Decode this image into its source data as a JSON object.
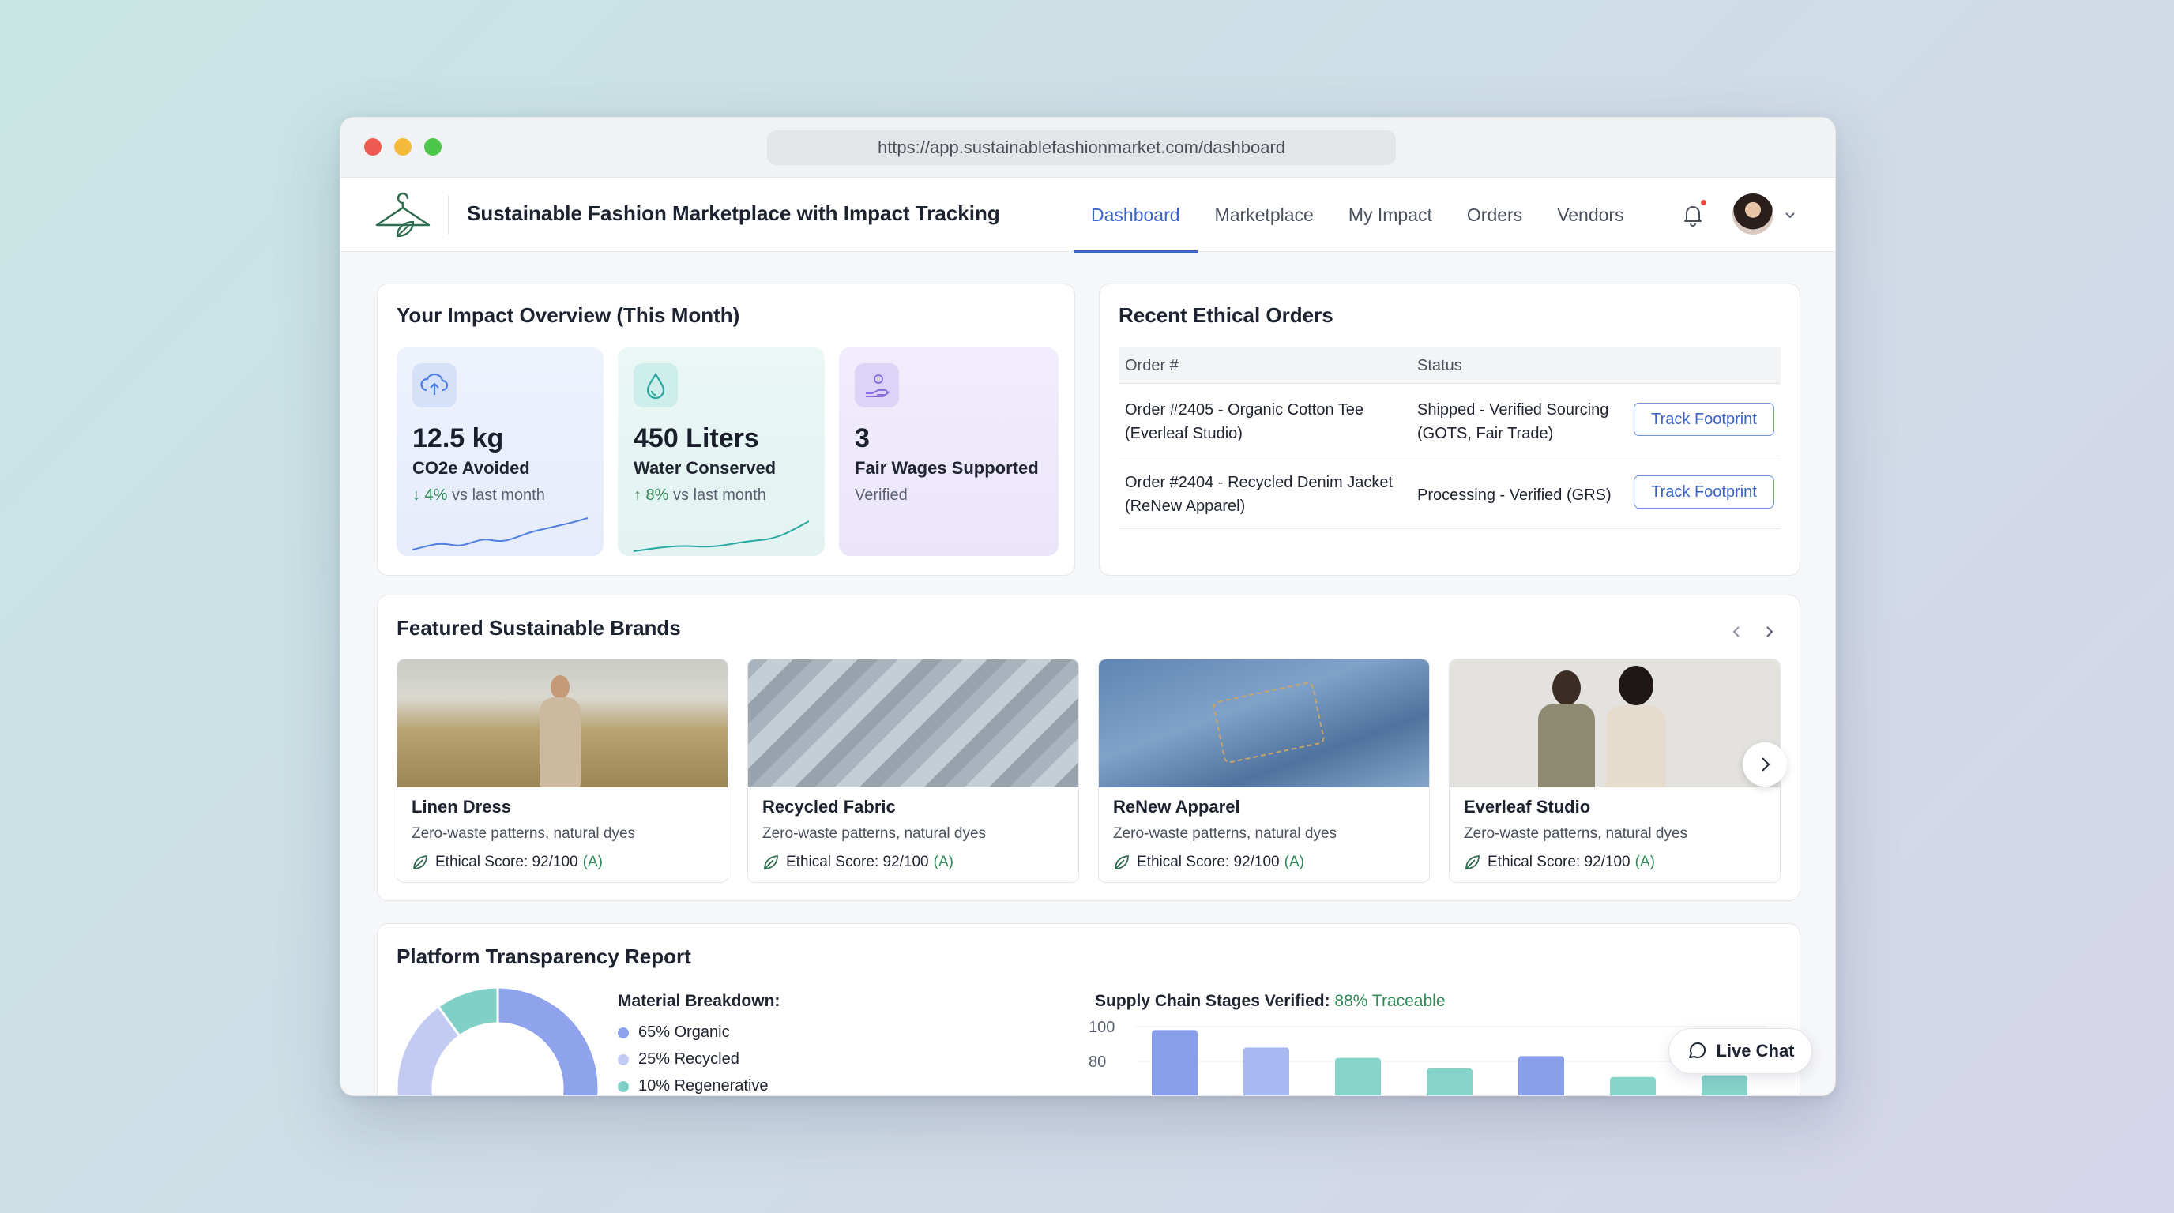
{
  "browser": {
    "url": "https://app.sustainablefashionmarket.com/dashboard"
  },
  "header": {
    "title": "Sustainable Fashion Marketplace with Impact Tracking",
    "nav": [
      {
        "label": "Dashboard",
        "active": true
      },
      {
        "label": "Marketplace"
      },
      {
        "label": "My Impact"
      },
      {
        "label": "Orders"
      },
      {
        "label": "Vendors"
      }
    ],
    "logo_icon": "hanger-leaf-icon",
    "notification_icon": "bell-icon"
  },
  "impact": {
    "title": "Your Impact Overview (This Month)",
    "stats": [
      {
        "value": "12.5 kg",
        "label": "CO2e Avoided",
        "delta_prefix": "↓ 4%",
        "delta_suffix": " vs last month",
        "icon": "cloud-upload-icon",
        "color": "#4f7fe0"
      },
      {
        "value": "450 Liters",
        "label": "Water Conserved",
        "delta_prefix": "↑ 8%",
        "delta_suffix": " vs last month",
        "icon": "water-drop-icon",
        "color": "#2aa7a0"
      },
      {
        "value": "3",
        "label": "Fair Wages Supported",
        "delta_prefix": "",
        "delta_suffix": "Verified",
        "icon": "hand-heart-icon",
        "color": "#8b6fe0"
      }
    ]
  },
  "orders": {
    "title": "Recent Ethical Orders",
    "columns": [
      "Order #",
      "Status"
    ],
    "rows": [
      {
        "order_line1": "Order #2405 - Organic Cotton Tee",
        "order_line2": "(Everleaf Studio)",
        "status_line1": "Shipped - Verified Sourcing",
        "status_line2": "(GOTS, Fair Trade)",
        "action": "Track Footprint"
      },
      {
        "order_line1": "Order #2404 - Recycled Denim Jacket",
        "order_line2": "(ReNew Apparel)",
        "status_line1": "Processing - Verified (GRS)",
        "status_line2": "",
        "action": "Track Footprint"
      }
    ]
  },
  "brands": {
    "title": "Featured Sustainable Brands",
    "items": [
      {
        "name": "Linen Dress",
        "desc": "Zero-waste patterns, natural dyes",
        "score": "Ethical Score: 92/100",
        "grade": "(A)"
      },
      {
        "name": "Recycled Fabric",
        "desc": "Zero-waste patterns, natural dyes",
        "score": "Ethical Score: 92/100",
        "grade": "(A)"
      },
      {
        "name": "ReNew Apparel",
        "desc": "Zero-waste patterns, natural dyes",
        "score": "Ethical Score: 92/100",
        "grade": "(A)"
      },
      {
        "name": "Everleaf Studio",
        "desc": "Zero-waste patterns, natural dyes",
        "score": "Ethical Score: 92/100",
        "grade": "(A)"
      }
    ]
  },
  "transparency": {
    "title": "Platform Transparency Report",
    "material_title": "Material Breakdown:",
    "materials": [
      {
        "label": "65% Organic",
        "value": 65,
        "color": "#8fa3ec"
      },
      {
        "label": "25% Recycled",
        "value": 25,
        "color": "#c3cbf3"
      },
      {
        "label": "10% Regenerative",
        "value": 10,
        "color": "#7fd0c6"
      }
    ],
    "supply_title": "Supply Chain Stages Verified: ",
    "supply_highlight": "88% Traceable"
  },
  "chart_data": {
    "type": "bar",
    "values": [
      98,
      88,
      82,
      76,
      83,
      71,
      72
    ],
    "colors": [
      "#8a9fec",
      "#a8b8f0",
      "#86d3ca",
      "#86d3ca",
      "#8a9fec",
      "#86d3ca",
      "#86d3ca"
    ],
    "yticks": [
      "100",
      "80"
    ],
    "ylim": [
      0,
      100
    ]
  },
  "livechat": {
    "label": "Live Chat"
  }
}
